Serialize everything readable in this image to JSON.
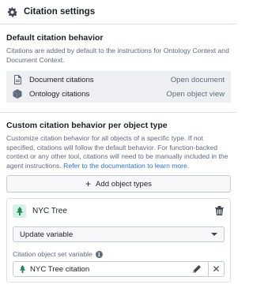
{
  "header": {
    "title": "Citation settings",
    "icon": "gear-icon"
  },
  "default_section": {
    "title": "Default citation behavior",
    "description": "Citations are added by default to the instructions for Ontology Context and Document Context.",
    "rows": [
      {
        "label": "Document citations",
        "action": "Open document",
        "icon": "document-icon"
      },
      {
        "label": "Ontology citations",
        "action": "Open object view",
        "icon": "cube-icon"
      }
    ]
  },
  "custom_section": {
    "title": "Custom citation behavior per object type",
    "description": "Customize citation behavior for all objects of a specific type. If not specified, citations will follow the default behavior. For function-backed context or any other tool, citations will need to be manually included in the agent instructions.",
    "link_text": "Refer to the documentation to learn more.",
    "add_button_label": "Add object types",
    "object_type": {
      "name": "NYC Tree",
      "icon": "tree-icon",
      "badge_color": "#d3f1e4",
      "icon_color": "#238551",
      "select_value": "Update variable",
      "field_label": "Citation object set variable",
      "field_value": "NYC Tree citation"
    }
  }
}
